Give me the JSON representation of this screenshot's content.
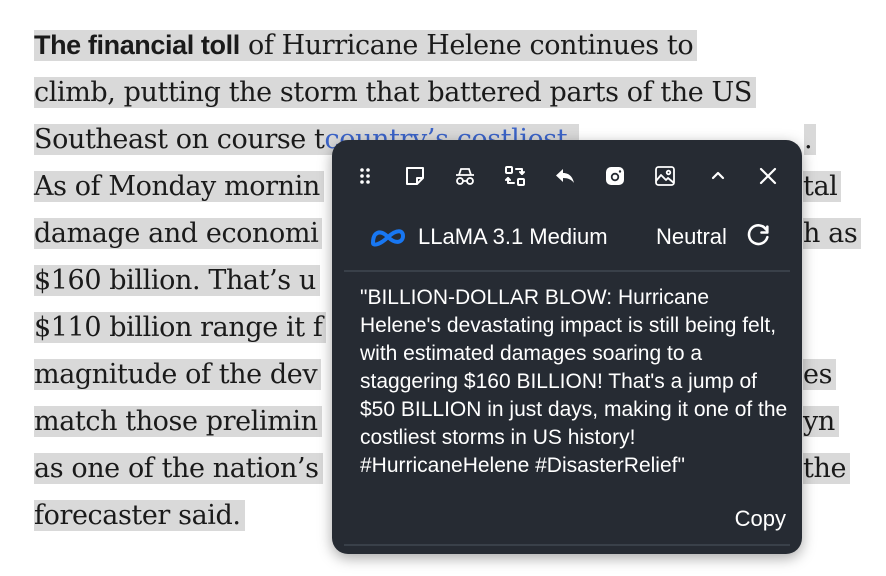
{
  "article": {
    "lines": [
      {
        "lead": "The financial toll",
        "text": " of Hurricane Helene continues to"
      },
      {
        "text": "climb, putting the storm that battered parts of the US"
      },
      {
        "text": "Southeast on course t",
        "link": "country’s costliest",
        "text2": "."
      },
      {
        "text": "As of Monday mornin",
        "text2": "tal"
      },
      {
        "text": "damage and economi",
        "text2": "h as"
      },
      {
        "text": "$160 billion. That’s u"
      },
      {
        "text": "$110 billion range it f"
      },
      {
        "text": "magnitude of the dev",
        "text2": "es"
      },
      {
        "text": "match those prelimin",
        "text2": "yn"
      },
      {
        "text": "as one of the nation’s",
        "text2": "the"
      },
      {
        "text": "forecaster said."
      }
    ]
  },
  "popup": {
    "model": {
      "icon": "meta-logo-icon",
      "name": "LLaMA 3.1 Medium"
    },
    "tone": "Neutral",
    "generated_text": "\"BILLION-DOLLAR BLOW: Hurricane Helene's devastating impact is still being felt, with estimated damages soaring to a staggering $160 BILLION! That's a jump of $50 BILLION in just days, making it one of the costliest storms in US history! #HurricaneHelene #DisasterRelief\"",
    "copy_label": "Copy"
  },
  "colors": {
    "popup_bg": "#262b33",
    "highlight": "#d9d9d9",
    "link": "#3b63c7",
    "meta_blue": "#1877f2"
  }
}
